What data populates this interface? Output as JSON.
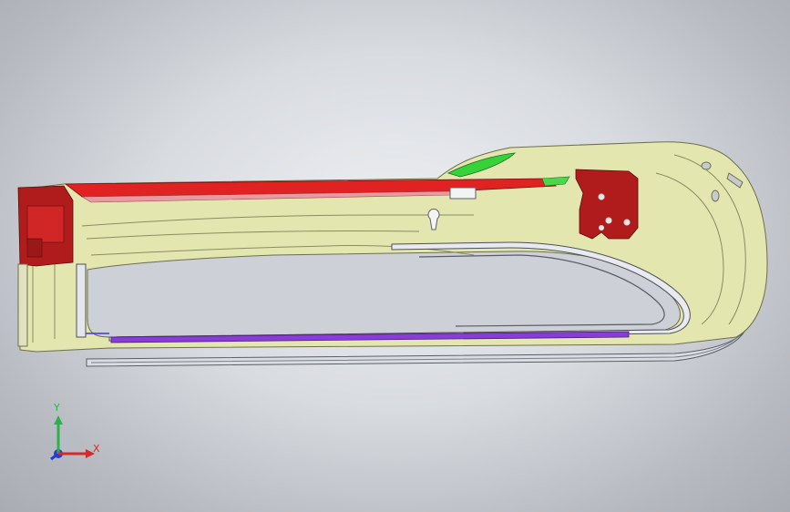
{
  "viewport": {
    "background_center": "#eef0f3",
    "background_edge": "#a9acb2"
  },
  "model": {
    "parts": [
      {
        "name": "shell-part",
        "color": "#e4e6b0"
      },
      {
        "name": "red-rail-part",
        "color": "#e02222"
      },
      {
        "name": "dark-red-bracket-part",
        "color": "#b01c1c"
      },
      {
        "name": "green-part",
        "color": "#36d23a"
      },
      {
        "name": "purple-rail-part",
        "color": "#8a3cd8"
      },
      {
        "name": "silver-tube-part",
        "color": "#cfd2d8"
      }
    ]
  },
  "triad": {
    "x_label": "X",
    "y_label": "Y",
    "x_color": "#d42a2a",
    "y_color": "#2db24a",
    "z_color": "#1f3fd6"
  }
}
